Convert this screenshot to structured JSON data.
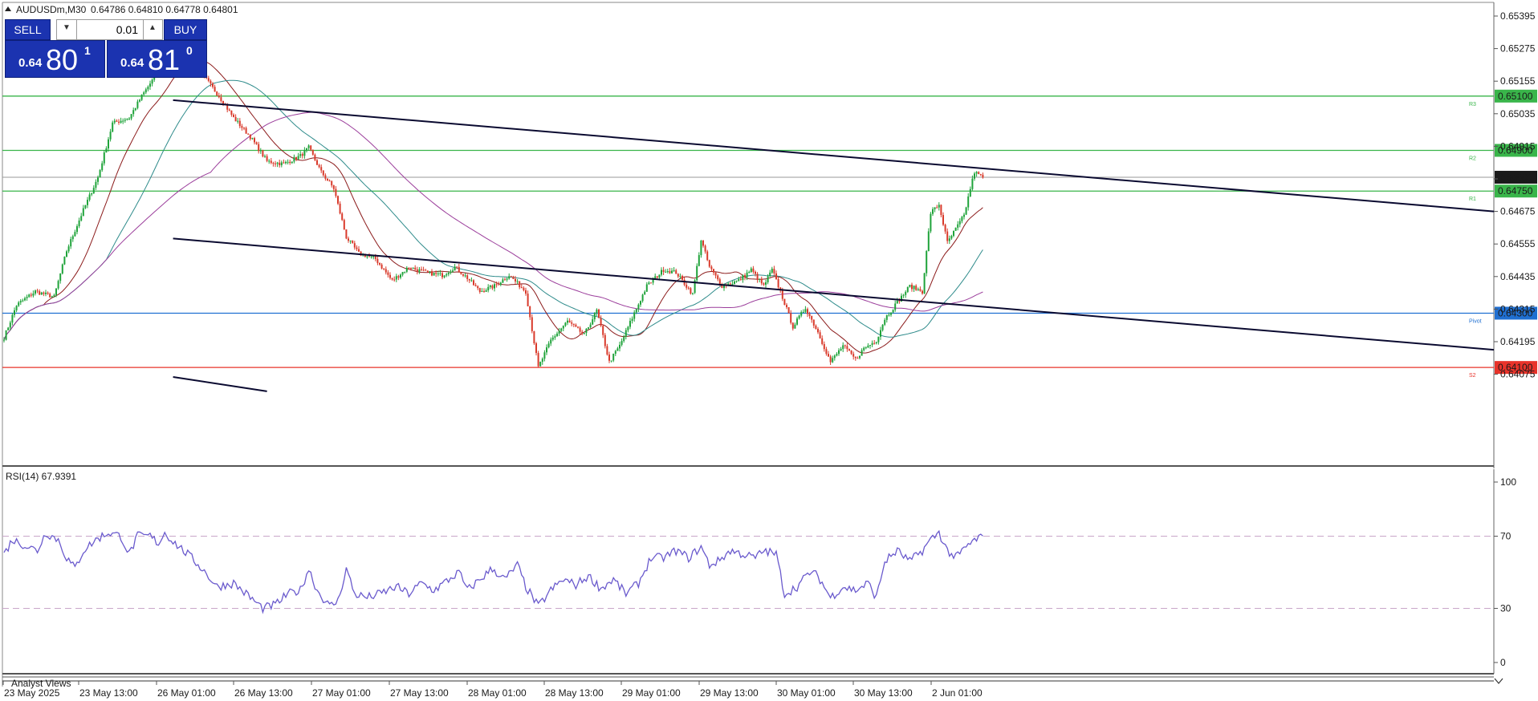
{
  "header": {
    "symbol_label": "AUDUSDm,M30",
    "ohlc": "0.64786 0.64810 0.64778 0.64801"
  },
  "trade_panel": {
    "sell_label": "SELL",
    "buy_label": "BUY",
    "volume": "0.01",
    "sell_price_prefix": "0.64",
    "sell_price_big": "80",
    "sell_price_sup": "1",
    "buy_price_prefix": "0.64",
    "buy_price_big": "81",
    "buy_price_sup": "0",
    "color": "#1b33b0"
  },
  "footer_label": "Analyst Views",
  "chart_data": [
    {
      "type": "candlestick",
      "symbol": "AUDUSDm",
      "timeframe": "M30",
      "price_ticks": [
        "0.65395",
        "0.65275",
        "0.65155",
        "0.65035",
        "0.64915",
        "0.64795",
        "0.64675",
        "0.64555",
        "0.64435",
        "0.64315",
        "0.64195",
        "0.64075"
      ],
      "time_ticks": [
        "23 May 2025",
        "23 May 13:00",
        "26 May 01:00",
        "26 May 13:00",
        "27 May 01:00",
        "27 May 13:00",
        "28 May 01:00",
        "28 May 13:00",
        "29 May 01:00",
        "29 May 13:00",
        "30 May 01:00",
        "30 May 13:00",
        "2 Jun 01:00"
      ],
      "current_price": "0.64801",
      "horizontal_levels": [
        {
          "label": "R3",
          "value": "0.65100",
          "color": "#39b54a"
        },
        {
          "label": "R2",
          "value": "0.64900",
          "color": "#39b54a"
        },
        {
          "label": "R1",
          "value": "0.64750",
          "color": "#39b54a"
        },
        {
          "label": "Pivot",
          "value": "0.64300",
          "color": "#1f6fd1"
        },
        {
          "label": "S2",
          "value": "0.64100",
          "color": "#e8332a"
        }
      ],
      "channel_lines": [
        {
          "from": {
            "bar": 81,
            "price": 0.65085
          },
          "to": {
            "bar": 464,
            "price": 0.64675
          }
        },
        {
          "from": {
            "bar": 81,
            "price": 0.64575
          },
          "to": {
            "bar": 464,
            "price": 0.64165
          }
        }
      ],
      "price_path_keypoints": [
        [
          0,
          0.6421
        ],
        [
          6,
          0.6433
        ],
        [
          15,
          0.6438
        ],
        [
          24,
          0.6436
        ],
        [
          30,
          0.6453
        ],
        [
          38,
          0.6468
        ],
        [
          45,
          0.648
        ],
        [
          52,
          0.65
        ],
        [
          60,
          0.6502
        ],
        [
          66,
          0.651
        ],
        [
          73,
          0.6518
        ],
        [
          80,
          0.6526
        ],
        [
          88,
          0.6524
        ],
        [
          95,
          0.6518
        ],
        [
          103,
          0.651
        ],
        [
          110,
          0.6502
        ],
        [
          118,
          0.6495
        ],
        [
          126,
          0.6486
        ],
        [
          134,
          0.6485
        ],
        [
          142,
          0.6488
        ],
        [
          146,
          0.6491
        ],
        [
          152,
          0.6482
        ],
        [
          158,
          0.6476
        ],
        [
          164,
          0.6458
        ],
        [
          170,
          0.6452
        ],
        [
          178,
          0.645
        ],
        [
          186,
          0.6442
        ],
        [
          194,
          0.6447
        ],
        [
          202,
          0.6445
        ],
        [
          210,
          0.6444
        ],
        [
          216,
          0.6447
        ],
        [
          222,
          0.6443
        ],
        [
          228,
          0.6438
        ],
        [
          235,
          0.644
        ],
        [
          242,
          0.6444
        ],
        [
          250,
          0.6438
        ],
        [
          256,
          0.641
        ],
        [
          262,
          0.642
        ],
        [
          270,
          0.6427
        ],
        [
          278,
          0.6422
        ],
        [
          284,
          0.6431
        ],
        [
          290,
          0.6412
        ],
        [
          295,
          0.6418
        ],
        [
          302,
          0.643
        ],
        [
          308,
          0.644
        ],
        [
          316,
          0.6446
        ],
        [
          322,
          0.6445
        ],
        [
          330,
          0.6437
        ],
        [
          334,
          0.6457
        ],
        [
          338,
          0.6447
        ],
        [
          344,
          0.644
        ],
        [
          352,
          0.6442
        ],
        [
          358,
          0.6446
        ],
        [
          364,
          0.644
        ],
        [
          368,
          0.6446
        ],
        [
          372,
          0.6438
        ],
        [
          378,
          0.6425
        ],
        [
          384,
          0.6432
        ],
        [
          390,
          0.6423
        ],
        [
          396,
          0.6412
        ],
        [
          402,
          0.6418
        ],
        [
          408,
          0.6413
        ],
        [
          412,
          0.6417
        ],
        [
          418,
          0.642
        ],
        [
          422,
          0.6428
        ],
        [
          428,
          0.6434
        ],
        [
          434,
          0.644
        ],
        [
          440,
          0.6438
        ],
        [
          444,
          0.6467
        ],
        [
          448,
          0.647
        ],
        [
          452,
          0.6456
        ],
        [
          456,
          0.6461
        ],
        [
          460,
          0.6466
        ],
        [
          463,
          0.6476
        ],
        [
          465,
          0.6482
        ],
        [
          469,
          0.648
        ]
      ]
    },
    {
      "type": "line",
      "title": "RSI(14) 67.9391",
      "ylim": [
        0,
        100
      ],
      "y_ticks": [
        "100",
        "70",
        "30",
        "0"
      ],
      "levels": [
        70,
        30
      ],
      "color": "#6a5acd",
      "values_keypoints": [
        [
          0,
          60
        ],
        [
          4,
          68
        ],
        [
          10,
          65
        ],
        [
          16,
          62
        ],
        [
          20,
          72
        ],
        [
          26,
          68
        ],
        [
          30,
          58
        ],
        [
          34,
          52
        ],
        [
          38,
          62
        ],
        [
          44,
          68
        ],
        [
          50,
          72
        ],
        [
          56,
          70
        ],
        [
          60,
          60
        ],
        [
          64,
          70
        ],
        [
          70,
          70
        ],
        [
          74,
          66
        ],
        [
          77,
          72
        ],
        [
          82,
          66
        ],
        [
          88,
          60
        ],
        [
          95,
          52
        ],
        [
          102,
          42
        ],
        [
          110,
          44
        ],
        [
          118,
          36
        ],
        [
          124,
          30
        ],
        [
          130,
          32
        ],
        [
          136,
          38
        ],
        [
          142,
          40
        ],
        [
          146,
          52
        ],
        [
          150,
          40
        ],
        [
          156,
          31
        ],
        [
          160,
          34
        ],
        [
          164,
          52
        ],
        [
          168,
          38
        ],
        [
          174,
          36
        ],
        [
          180,
          38
        ],
        [
          188,
          42
        ],
        [
          194,
          38
        ],
        [
          200,
          44
        ],
        [
          206,
          40
        ],
        [
          212,
          45
        ],
        [
          218,
          50
        ],
        [
          222,
          40
        ],
        [
          228,
          46
        ],
        [
          234,
          52
        ],
        [
          240,
          46
        ],
        [
          246,
          54
        ],
        [
          250,
          42
        ],
        [
          256,
          31
        ],
        [
          262,
          40
        ],
        [
          268,
          46
        ],
        [
          274,
          43
        ],
        [
          280,
          48
        ],
        [
          286,
          41
        ],
        [
          292,
          46
        ],
        [
          298,
          38
        ],
        [
          304,
          44
        ],
        [
          310,
          58
        ],
        [
          316,
          58
        ],
        [
          322,
          62
        ],
        [
          328,
          58
        ],
        [
          334,
          64
        ],
        [
          338,
          54
        ],
        [
          342,
          56
        ],
        [
          348,
          62
        ],
        [
          354,
          60
        ],
        [
          360,
          58
        ],
        [
          364,
          62
        ],
        [
          370,
          60
        ],
        [
          374,
          38
        ],
        [
          380,
          42
        ],
        [
          386,
          50
        ],
        [
          390,
          48
        ],
        [
          396,
          36
        ],
        [
          402,
          42
        ],
        [
          408,
          40
        ],
        [
          414,
          44
        ],
        [
          418,
          36
        ],
        [
          422,
          56
        ],
        [
          428,
          62
        ],
        [
          434,
          56
        ],
        [
          440,
          62
        ],
        [
          444,
          68
        ],
        [
          448,
          72
        ],
        [
          452,
          62
        ],
        [
          456,
          58
        ],
        [
          462,
          65
        ],
        [
          468,
          70
        ],
        [
          469,
          68
        ]
      ]
    }
  ]
}
